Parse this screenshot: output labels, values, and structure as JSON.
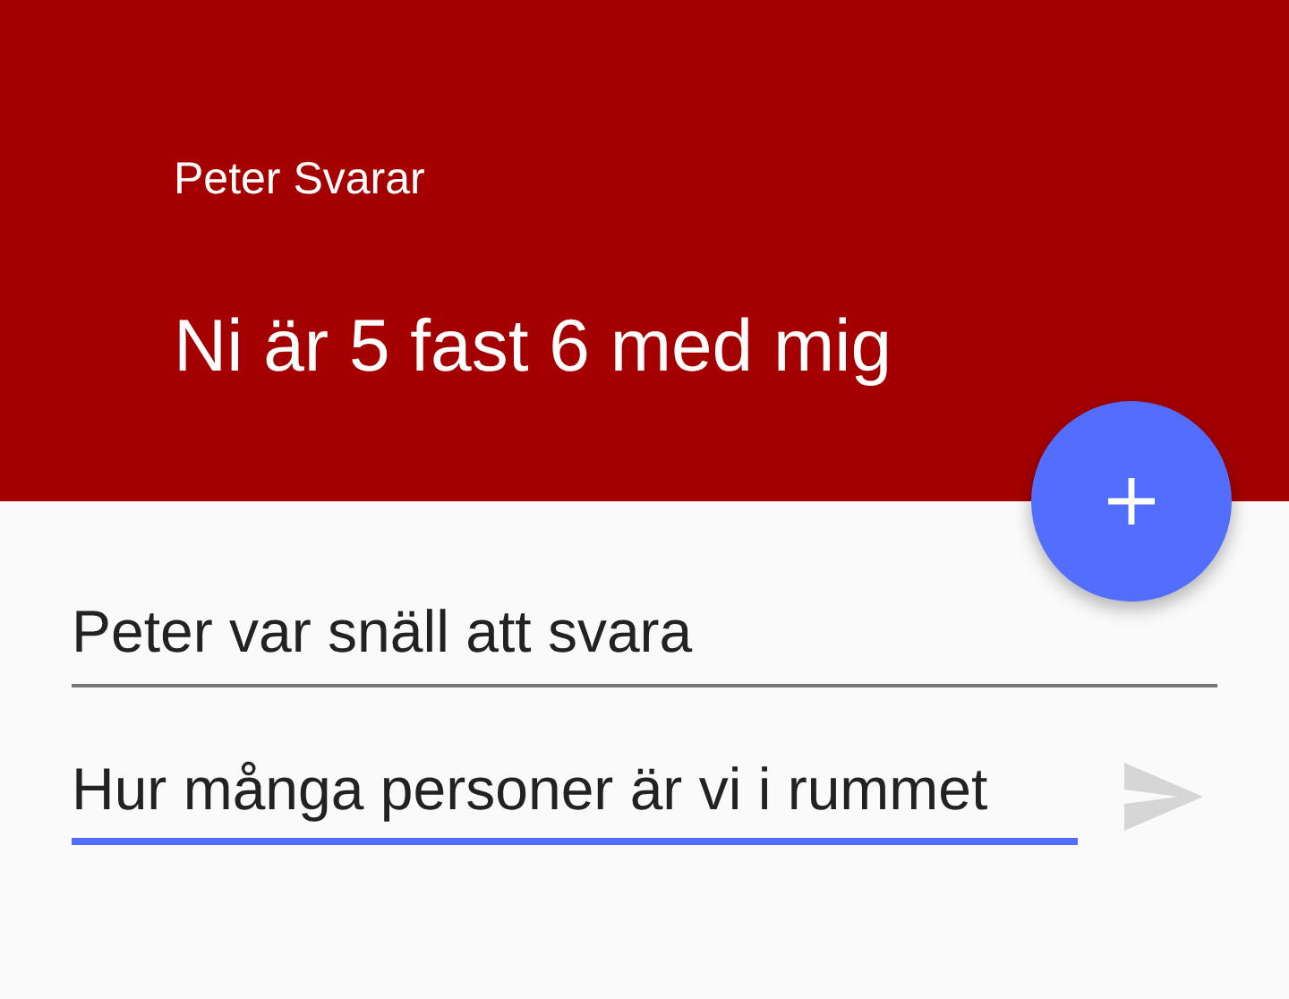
{
  "header": {
    "subtitle": "Peter Svarar",
    "title": "Ni är 5 fast 6 med mig"
  },
  "fields": [
    {
      "value": "Peter var snäll att svara",
      "focused": false
    },
    {
      "value": "Hur många personer är vi i rummet",
      "focused": true
    }
  ],
  "send_button": {
    "disabled": true
  }
}
